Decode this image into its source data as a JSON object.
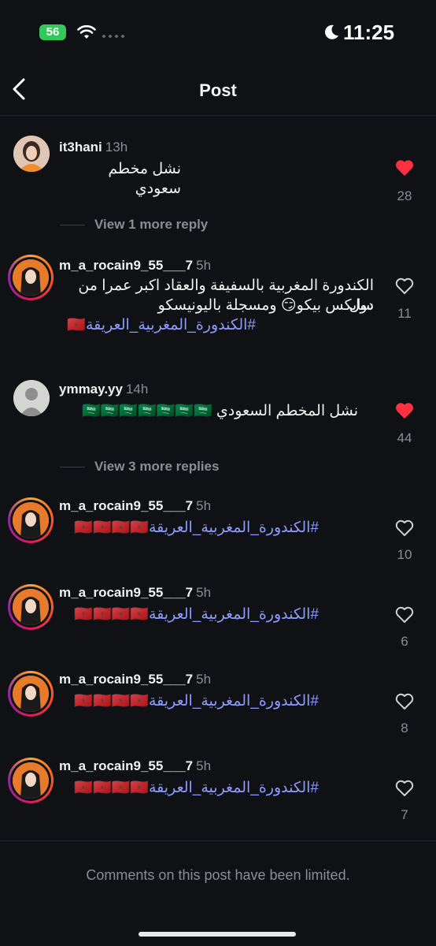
{
  "status_bar": {
    "battery": "56",
    "time": "11:25"
  },
  "nav": {
    "title": "Post"
  },
  "comments": [
    {
      "username": "it3hani",
      "time": "13h",
      "text": "نشل مخطم سعودي",
      "likes": "28",
      "liked": true
    },
    {
      "username": "m_a_rocain9_55___7",
      "time": "5h",
      "text_line1": "الكندورة المغربية بالسفيفة والعقاد اكبر عمرا من دول",
      "text_line2": "سايكس بيكو😏 ومسجلة باليونيسكو",
      "text_line3": "#الكندورة_المغربية_العريقة🇲🇦",
      "likes": "11",
      "liked": false
    },
    {
      "username": "ymmay.yy",
      "time": "14h",
      "text": "نشل المخطم السعودي 🇸🇦🇸🇦🇸🇦🇸🇦🇸🇦🇸🇦🇸🇦",
      "likes": "44",
      "liked": true
    },
    {
      "username": "m_a_rocain9_55___7",
      "time": "5h",
      "text": "#الكندورة_المغربية_العريقة🇲🇦🇲🇦🇲🇦🇲🇦",
      "likes": "10",
      "liked": false
    },
    {
      "username": "m_a_rocain9_55___7",
      "time": "5h",
      "text": "#الكندورة_المغربية_العريقة🇲🇦🇲🇦🇲🇦🇲🇦",
      "likes": "6",
      "liked": false
    },
    {
      "username": "m_a_rocain9_55___7",
      "time": "5h",
      "text": "#الكندورة_المغربية_العريقة🇲🇦🇲🇦🇲🇦🇲🇦",
      "likes": "8",
      "liked": false
    },
    {
      "username": "m_a_rocain9_55___7",
      "time": "5h",
      "text": "#الكندورة_المغربية_العريقة🇲🇦🇲🇦🇲🇦🇲🇦",
      "likes": "7",
      "liked": false
    }
  ],
  "replies": [
    "View 1 more reply",
    "View 3 more replies"
  ],
  "footer": {
    "limited": "Comments on this post have been limited."
  },
  "icons": {
    "back": "chevron-left-icon",
    "heart": "heart-icon",
    "wifi": "wifi-icon",
    "moon": "moon-icon"
  },
  "colors": {
    "liked": "#ff3040",
    "hashtag": "#8e9cff",
    "background": "#0f1115"
  }
}
